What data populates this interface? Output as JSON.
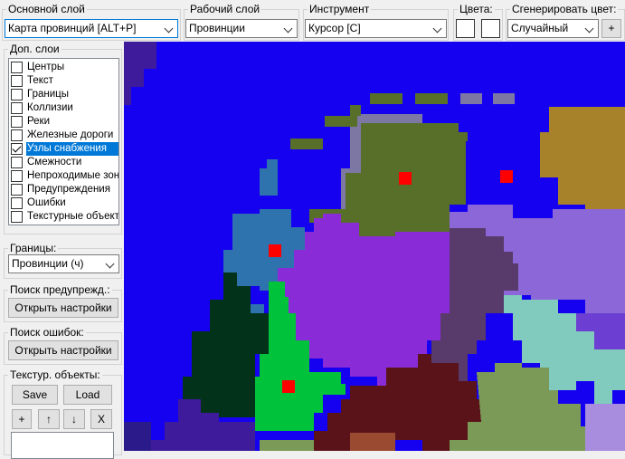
{
  "toolbar": {
    "base_layer": {
      "label": "Основной слой",
      "value": "Карта провинций [ALT+P]"
    },
    "work_layer": {
      "label": "Рабочий слой",
      "value": "Провинции"
    },
    "tool": {
      "label": "Инструмент",
      "value": "Курсор [C]"
    },
    "colors": {
      "label": "Цвета:"
    },
    "generate_color": {
      "label": "Сгенерировать цвет:",
      "value": "Случайный",
      "add_label": "+"
    }
  },
  "sidebar": {
    "extra_layers": {
      "title": "Доп. слои",
      "items": [
        {
          "label": "Центры",
          "checked": false
        },
        {
          "label": "Текст",
          "checked": false
        },
        {
          "label": "Границы",
          "checked": false
        },
        {
          "label": "Коллизии",
          "checked": false
        },
        {
          "label": "Реки",
          "checked": false
        },
        {
          "label": "Железные дороги",
          "checked": false
        },
        {
          "label": "Узлы снабжения",
          "checked": true,
          "selected": true
        },
        {
          "label": "Смежности",
          "checked": false
        },
        {
          "label": "Непроходимые зоны",
          "checked": false
        },
        {
          "label": "Предупреждения",
          "checked": false
        },
        {
          "label": "Ошибки",
          "checked": false
        },
        {
          "label": "Текстурные объекты",
          "checked": false
        }
      ]
    },
    "borders": {
      "title": "Границы:",
      "value": "Провинции (ч)"
    },
    "warning_search": {
      "title": "Поиск предупрежд.:",
      "button": "Открыть настройки"
    },
    "error_search": {
      "title": "Поиск ошибок:",
      "button": "Открыть настройки"
    },
    "texture_objects": {
      "title": "Текстур. объекты:",
      "save": "Save",
      "load": "Load",
      "add": "+",
      "up": "↑",
      "down": "↓",
      "remove": "X"
    }
  },
  "map": {
    "background_color": "#1500f0",
    "province_colors": {
      "blue": "#2e72ae",
      "olive": "#586f2a",
      "grey_purple": "#7d77a4",
      "ochre": "#a7822b",
      "lavender": "#8c67d8",
      "violet": "#8a2bd8",
      "dark_plum": "#583a6b",
      "dark_green": "#02331a",
      "green": "#00c23b",
      "teal": "#80cbbd",
      "sage": "#7b9a58",
      "maroon": "#5a1419",
      "indigo": "#3e1b9b",
      "purple_far": "#6c3fd2",
      "light_purple": "#a88cdd",
      "dark_olive": "#4a6a36",
      "brick": "#9a4a30",
      "navy_edge": "#2a1a8a"
    },
    "supply_node_color": "#ff0000"
  }
}
